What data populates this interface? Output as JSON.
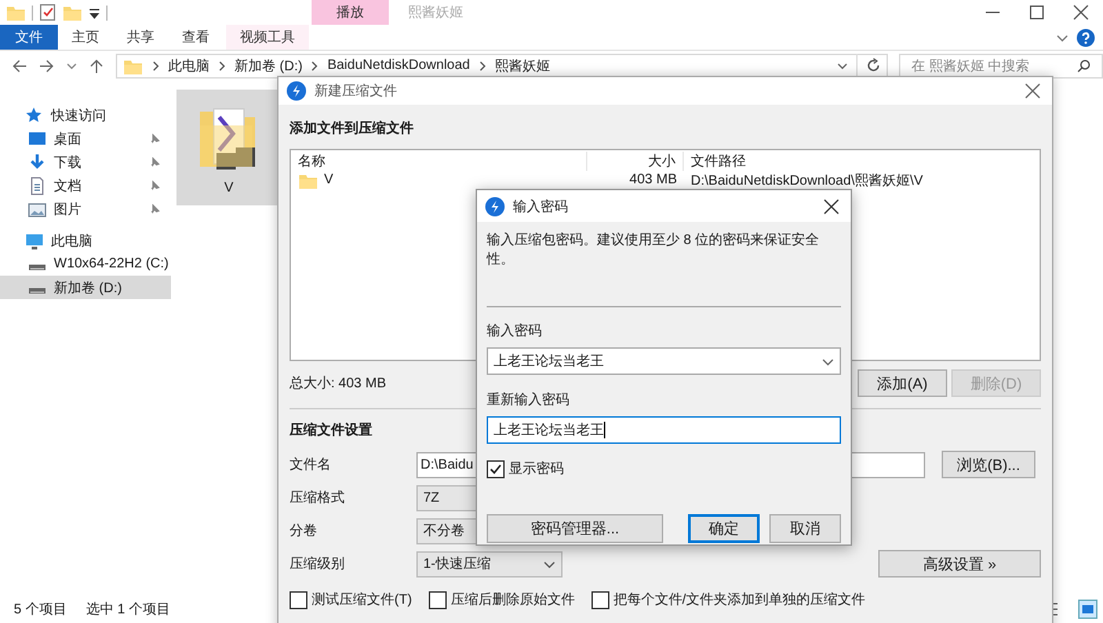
{
  "explorer": {
    "title": "熙酱妖姬",
    "context_group": "播放",
    "ribbon_tabs": [
      {
        "label": "文件",
        "kind": "file",
        "selected": false
      },
      {
        "label": "主页",
        "kind": "tab",
        "selected": false
      },
      {
        "label": "共享",
        "kind": "tab",
        "selected": false
      },
      {
        "label": "查看",
        "kind": "tab",
        "selected": false
      },
      {
        "label": "视频工具",
        "kind": "context",
        "selected": false
      }
    ],
    "breadcrumbs": [
      "此电脑",
      "新加卷 (D:)",
      "BaiduNetdiskDownload",
      "熙酱妖姬"
    ],
    "search": {
      "placeholder": "在 熙酱妖姬 中搜索"
    },
    "nav": [
      {
        "label": "快速访问",
        "kind": "star",
        "selected": false,
        "children": [
          {
            "label": "桌面",
            "kind": "desktop",
            "pinned": true,
            "selected": false
          },
          {
            "label": "下载",
            "kind": "download",
            "pinned": true,
            "selected": false
          },
          {
            "label": "文档",
            "kind": "document",
            "pinned": true,
            "selected": false
          },
          {
            "label": "图片",
            "kind": "picture",
            "pinned": true,
            "selected": false
          }
        ]
      },
      {
        "label": "此电脑",
        "kind": "computer",
        "selected": false,
        "children": [
          {
            "label": "W10x64-22H2 (C:)",
            "kind": "drive",
            "selected": false
          },
          {
            "label": "新加卷 (D:)",
            "kind": "drive",
            "selected": true
          }
        ]
      }
    ],
    "files": [
      {
        "name": "V",
        "selected": true
      }
    ],
    "status_bar": [
      "5 个项目",
      "选中 1 个项目"
    ]
  },
  "archive_dialog": {
    "title": "新建压缩文件",
    "section": "添加文件到压缩文件",
    "columns": [
      "名称",
      "大小",
      "文件路径"
    ],
    "rows": [
      {
        "name": "V",
        "size": "403 MB",
        "path": "D:\\BaiduNetdiskDownload\\熙酱妖姬\\V"
      }
    ],
    "total": "总大小: 403 MB",
    "list_buttons": [
      {
        "label": "添加(A)",
        "disabled": false
      },
      {
        "label": "删除(D)",
        "disabled": true
      }
    ],
    "settings_title": "压缩文件设置",
    "fields": [
      {
        "label": "文件名",
        "kind": "text",
        "value": "D:\\Baidu"
      },
      {
        "label": "压缩格式",
        "kind": "select",
        "value": "7Z"
      },
      {
        "label": "分卷",
        "kind": "select",
        "value": "不分卷"
      },
      {
        "label": "压缩级别",
        "kind": "select",
        "value": "1-快速压缩"
      }
    ],
    "browse_button": "浏览(B)...",
    "advanced_button": "高级设置 »",
    "options": [
      {
        "label": "测试压缩文件(T)",
        "checked": false
      },
      {
        "label": "压缩后删除原始文件",
        "checked": false
      },
      {
        "label": "把每个文件/文件夹添加到单独的压缩文件",
        "checked": false
      }
    ]
  },
  "password_dialog": {
    "title": "输入密码",
    "hint": "输入压缩包密码。建议使用至少 8 位的密码来保证安全性。",
    "password": {
      "label": "输入密码",
      "value": "上老王论坛当老王"
    },
    "confirm": {
      "label": "重新输入密码",
      "value": "上老王论坛当老王"
    },
    "show_password": {
      "label": "显示密码",
      "checked": true
    },
    "buttons": [
      {
        "label": "密码管理器...",
        "default": false
      },
      {
        "label": "确定",
        "default": true
      },
      {
        "label": "取消",
        "default": false
      }
    ]
  }
}
